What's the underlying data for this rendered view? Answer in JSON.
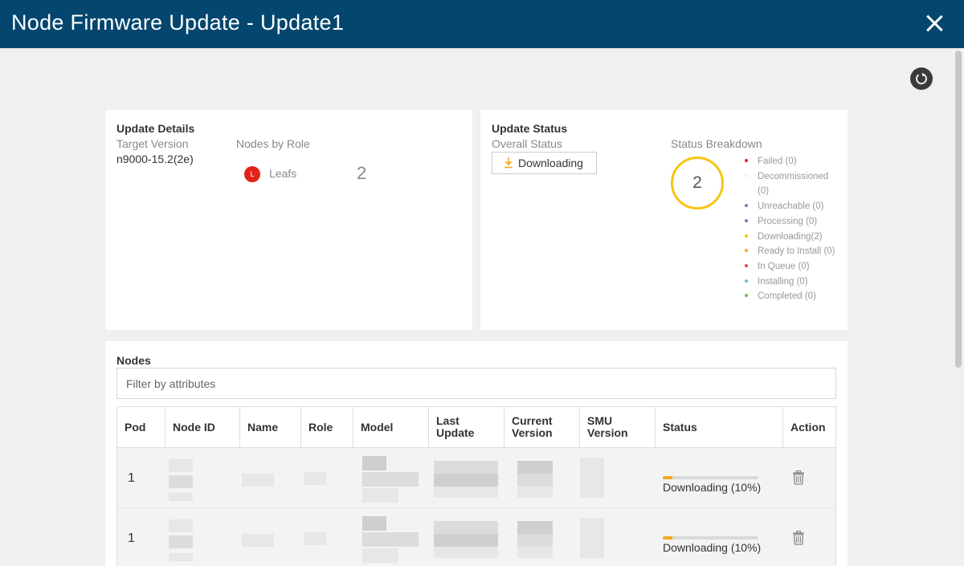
{
  "header": {
    "title": "Node Firmware Update - Update1"
  },
  "update_details": {
    "title": "Update Details",
    "target_version_label": "Target Version",
    "target_version": "n9000-15.2(2e)",
    "nodes_by_role_label": "Nodes by Role",
    "role_badge": "L",
    "role_name": "Leafs",
    "role_count": "2"
  },
  "update_status": {
    "title": "Update Status",
    "overall_status_label": "Overall Status",
    "overall_status": "Downloading",
    "breakdown_label": "Status Breakdown",
    "total": "2",
    "legend": [
      {
        "label": "Failed (0)",
        "color": "#e2231a"
      },
      {
        "label": "Decommissioned (0)",
        "color": "#f2f2f2"
      },
      {
        "label": "Unreachable (0)",
        "color": "#8f6fc4"
      },
      {
        "label": "Processing (0)",
        "color": "#8f6fc4"
      },
      {
        "label": "Downloading(2)",
        "color": "#f7c412"
      },
      {
        "label": "Ready to Install (0)",
        "color": "#f5a623"
      },
      {
        "label": "In Queue (0)",
        "color": "#d84c4c"
      },
      {
        "label": "Installing (0)",
        "color": "#64bbe3"
      },
      {
        "label": "Completed (0)",
        "color": "#6cc04a"
      }
    ]
  },
  "nodes": {
    "title": "Nodes",
    "filter_placeholder": "Filter by attributes",
    "columns": [
      "Pod",
      "Node ID",
      "Name",
      "Role",
      "Model",
      "Last Update",
      "Current Version",
      "SMU Version",
      "Status",
      "Action"
    ],
    "rows": [
      {
        "pod": "1",
        "status": "Downloading (10%)",
        "progress": 0.1
      },
      {
        "pod": "1",
        "status": "Downloading (10%)",
        "progress": 0.1
      }
    ]
  },
  "icons": [
    "close-icon",
    "refresh-icon",
    "download-icon",
    "trash-icon"
  ]
}
